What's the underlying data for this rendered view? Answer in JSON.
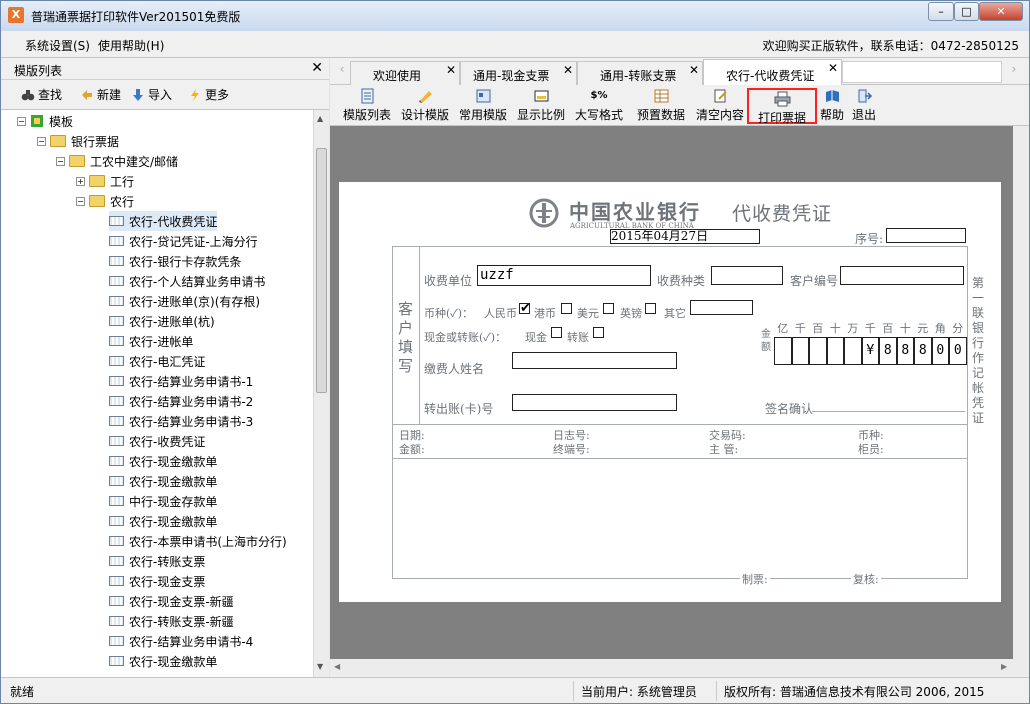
{
  "window": {
    "title": "普瑞通票据打印软件Ver201501免费版",
    "icon": "Ⅹ",
    "controls": {
      "minimize": "–",
      "maximize": "□",
      "close": "✕"
    }
  },
  "menu": {
    "items": [
      "系统设置(S)",
      "使用帮助(H)"
    ],
    "welcome": "欢迎购买正版软件，联系电话：0472-2850125"
  },
  "left_pane": {
    "title": "模版列表",
    "close_label": "✕",
    "toolbar": [
      {
        "label": "查找",
        "icon": "binoculars-icon"
      },
      {
        "label": "新建",
        "icon": "new-icon"
      },
      {
        "label": "导入",
        "icon": "import-icon"
      },
      {
        "label": "更多",
        "icon": "lightning-icon"
      }
    ],
    "tree": {
      "root": "模板",
      "bank": "银行票据",
      "group": "工农中建交/邮储",
      "icbc": "工行",
      "abc": "农行",
      "items": [
        "农行-代收费凭证",
        "农行-贷记凭证-上海分行",
        "农行-银行卡存款凭条",
        "农行-个人结算业务申请书",
        "农行-进账单(京)(有存根)",
        "农行-进账单(杭)",
        "农行-进帐单",
        "农行-电汇凭证",
        "农行-结算业务申请书-1",
        "农行-结算业务申请书-2",
        "农行-结算业务申请书-3",
        "农行-收费凭证",
        "农行-现金缴款单",
        "农行-现金缴款单",
        "中行-现金存款单",
        "农行-现金缴款单",
        "农行-本票申请书(上海市分行)",
        "农行-转账支票",
        "农行-现金支票",
        "农行-现金支票-新疆",
        "农行-转账支票-新疆",
        "农行-结算业务申请书-4",
        "农行-现金缴款单"
      ]
    }
  },
  "tabs": [
    {
      "label": "欢迎使用",
      "close": "✕"
    },
    {
      "label": "通用-现金支票",
      "close": "✕"
    },
    {
      "label": "通用-转账支票",
      "close": "✕"
    },
    {
      "label": "农行-代收费凭证",
      "close": "✕",
      "active": true
    }
  ],
  "toolbar": [
    {
      "label": "模版列表",
      "icon": "template-list-icon"
    },
    {
      "label": "设计模版",
      "icon": "design-icon"
    },
    {
      "label": "常用模版",
      "icon": "common-template-icon"
    },
    {
      "label": "显示比例",
      "icon": "zoom-icon"
    },
    {
      "label": "大写格式",
      "icon": "currency-format-icon",
      "glyph": "$%"
    },
    {
      "label": "预置数据",
      "icon": "preset-data-icon"
    },
    {
      "label": "清空内容",
      "icon": "clear-content-icon"
    },
    {
      "label": "打印票据",
      "icon": "printer-icon",
      "highlighted": true
    },
    {
      "label": "帮助",
      "icon": "help-book-icon"
    },
    {
      "label": "退出",
      "icon": "exit-icon"
    }
  ],
  "voucher": {
    "bank_name_cn": "中国农业银行",
    "bank_name_en": "AGRICULTURAL BANK OF CHINA",
    "doc_title": "代收费凭证",
    "date": "2015年04月27日",
    "serial_label": "序号:",
    "side_label": "客户填写",
    "right_label": "第一联 银行作记帐凭证",
    "payee_label": "收费单位",
    "payee_value": "uzzf",
    "fee_type_label": "收费种类",
    "customer_no_label": "客户编号",
    "currency_label": "币种(✓)：",
    "rmb": "人民币",
    "rmb_check": "✔",
    "hkd": "港币",
    "usd": "美元",
    "gbp": "英镑",
    "other": "其它",
    "cash_transfer_label": "现金或转账(✓)：",
    "cash": "现金",
    "transfer": "转账",
    "amount_label": "金额",
    "amount_units": [
      "亿",
      "千",
      "百",
      "十",
      "万",
      "千",
      "百",
      "十",
      "元",
      "角",
      "分"
    ],
    "amount_digits": [
      "",
      "",
      "",
      "",
      "",
      "¥",
      "8",
      "8",
      "8",
      "0",
      "0"
    ],
    "payer_label": "缴费人姓名",
    "account_label": "转出账(卡)号",
    "signature_label": "签名确认",
    "date_label": "日期:",
    "journal_label": "日志号:",
    "trans_code_label": "交易码:",
    "currency_kind_label": "币种:",
    "amount2_label": "金额:",
    "terminal_label": "终端号:",
    "supervisor_label": "主 管:",
    "teller_label": "柜员:",
    "maker_label": "制票:",
    "reviewer_label": "复核:"
  },
  "status": {
    "ready": "就绪",
    "user": "当前用户: 系统管理员",
    "copyright": "版权所有: 普瑞通信息技术有限公司 2006, 2015"
  }
}
